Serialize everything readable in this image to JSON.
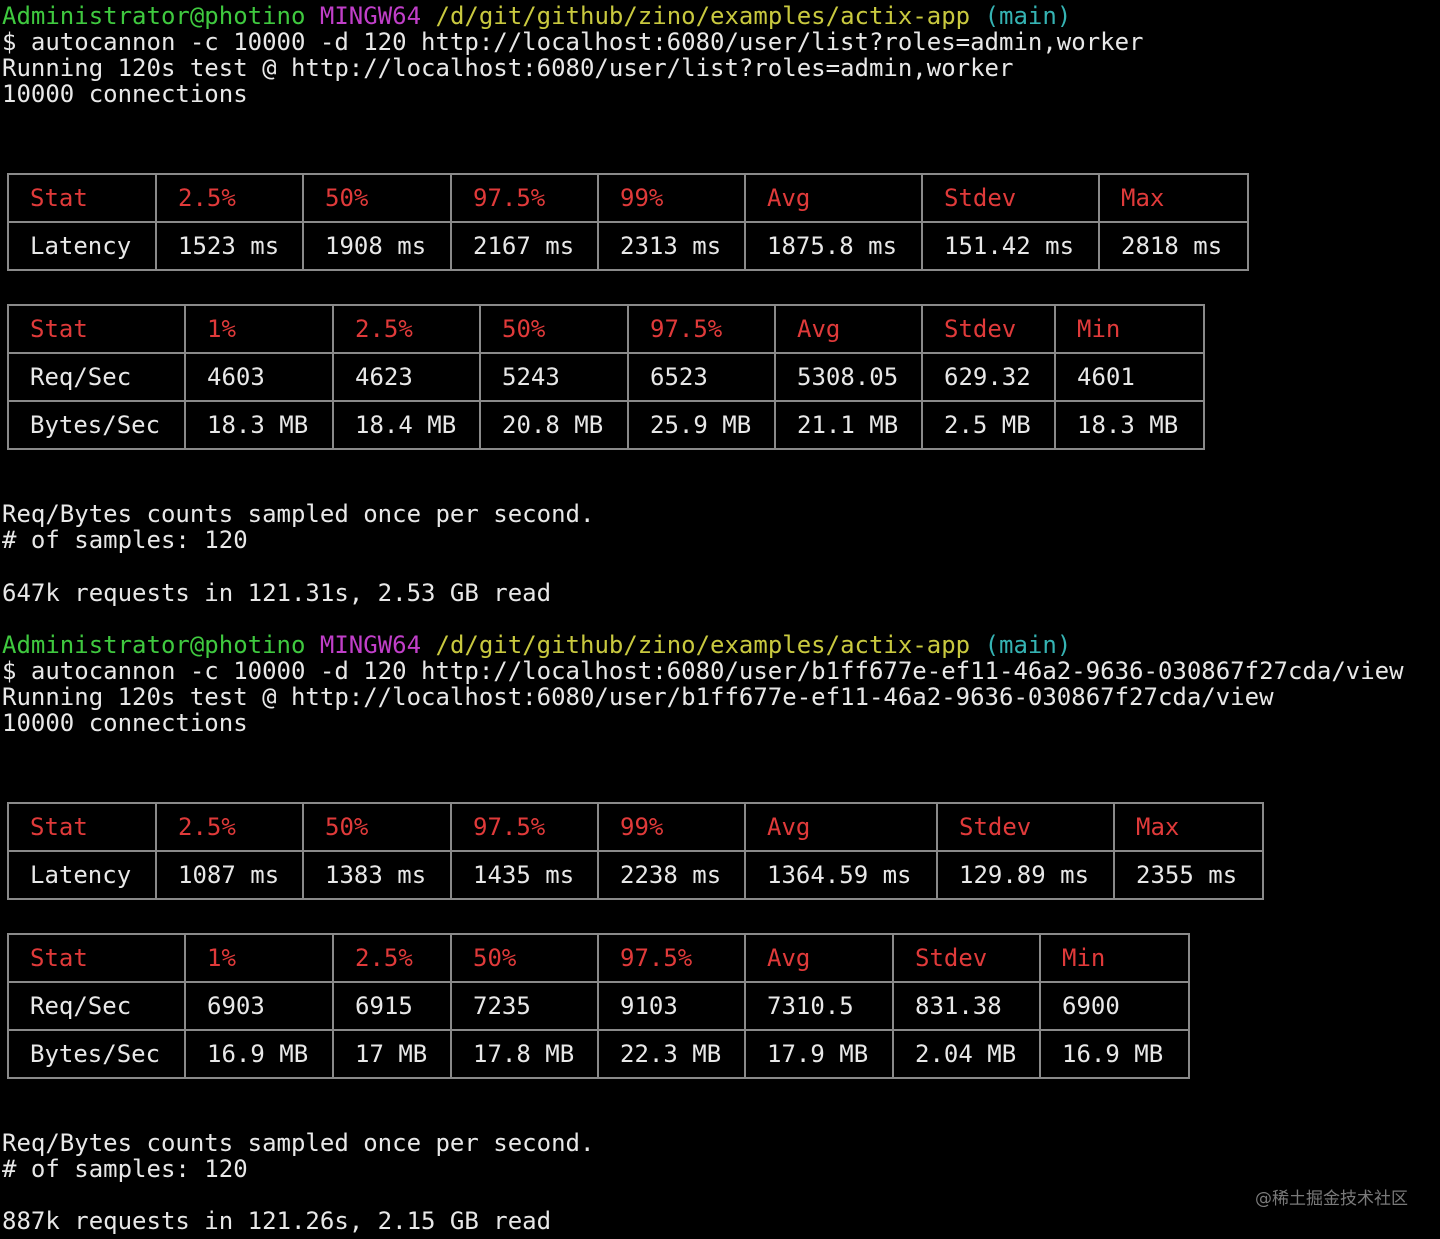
{
  "prompt": {
    "user_host": "Administrator@photino",
    "system": "MINGW64",
    "path": "/d/git/github/zino/examples/actix-app",
    "branch": "(main)"
  },
  "runs": [
    {
      "command": "$ autocannon -c 10000 -d 120 http://localhost:6080/user/list?roles=admin,worker",
      "running": "Running 120s test @ http://localhost:6080/user/list?roles=admin,worker",
      "connections": "10000 connections",
      "latency": {
        "headers": [
          "Stat",
          "2.5%",
          "50%",
          "97.5%",
          "99%",
          "Avg",
          "Stdev",
          "Max"
        ],
        "row": [
          "Latency",
          "1523 ms",
          "1908 ms",
          "2167 ms",
          "2313 ms",
          "1875.8 ms",
          "151.42 ms",
          "2818 ms"
        ]
      },
      "throughput": {
        "headers": [
          "Stat",
          "1%",
          "2.5%",
          "50%",
          "97.5%",
          "Avg",
          "Stdev",
          "Min"
        ],
        "req_row": [
          "Req/Sec",
          "4603",
          "4623",
          "5243",
          "6523",
          "5308.05",
          "629.32",
          "4601"
        ],
        "bytes_row": [
          "Bytes/Sec",
          "18.3 MB",
          "18.4 MB",
          "20.8 MB",
          "25.9 MB",
          "21.1 MB",
          "2.5 MB",
          "18.3 MB"
        ]
      },
      "sampled_note": "Req/Bytes counts sampled once per second.",
      "samples": "# of samples: 120",
      "summary": "647k requests in 121.31s, 2.53 GB read"
    },
    {
      "command": "$ autocannon -c 10000 -d 120 http://localhost:6080/user/b1ff677e-ef11-46a2-9636-030867f27cda/view",
      "running": "Running 120s test @ http://localhost:6080/user/b1ff677e-ef11-46a2-9636-030867f27cda/view",
      "connections": "10000 connections",
      "latency": {
        "headers": [
          "Stat",
          "2.5%",
          "50%",
          "97.5%",
          "99%",
          "Avg",
          "Stdev",
          "Max"
        ],
        "row": [
          "Latency",
          "1087 ms",
          "1383 ms",
          "1435 ms",
          "2238 ms",
          "1364.59 ms",
          "129.89 ms",
          "2355 ms"
        ]
      },
      "throughput": {
        "headers": [
          "Stat",
          "1%",
          "2.5%",
          "50%",
          "97.5%",
          "Avg",
          "Stdev",
          "Min"
        ],
        "req_row": [
          "Req/Sec",
          "6903",
          "6915",
          "7235",
          "9103",
          "7310.5",
          "831.38",
          "6900"
        ],
        "bytes_row": [
          "Bytes/Sec",
          "16.9 MB",
          "17 MB",
          "17.8 MB",
          "22.3 MB",
          "17.9 MB",
          "2.04 MB",
          "16.9 MB"
        ]
      },
      "sampled_note": "Req/Bytes counts sampled once per second.",
      "samples": "# of samples: 120",
      "summary": "887k requests in 121.26s, 2.15 GB read"
    }
  ],
  "watermark": "@稀土掘金技术社区",
  "colors": {
    "background": "#000000",
    "text": "#e8e8e8",
    "user_host": "#3fc93f",
    "system": "#c13fc9",
    "path": "#c9c93f",
    "branch": "#35b3b3",
    "table_header": "#e03a3a",
    "table_border": "#8a8a8a"
  }
}
